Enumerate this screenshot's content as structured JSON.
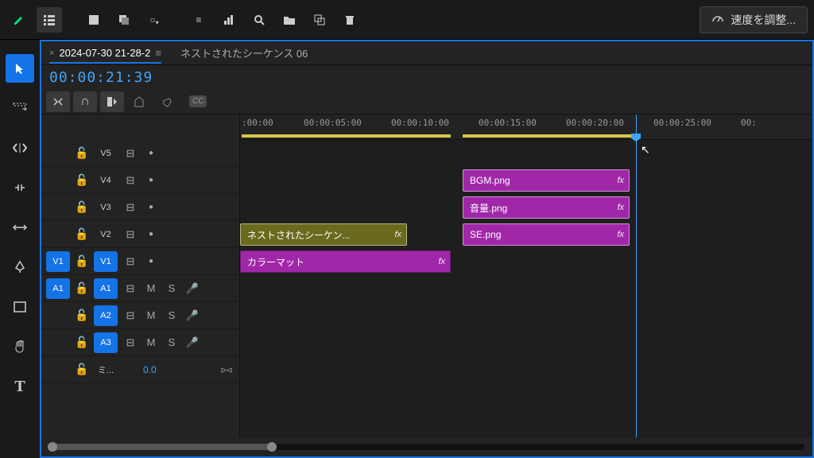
{
  "topbar": {
    "speed_label": "速度を調整..."
  },
  "tabs": {
    "active_label": "2024-07-30 21-28-2",
    "inactive_label": "ネストされたシーケンス 06"
  },
  "timecode": "00:00:21:39",
  "ruler": {
    "marks": [
      ":00:00",
      "00:00:05:00",
      "00:00:10:00",
      "00:00:15:00",
      "00:00:20:00",
      "00:00:25:00",
      "00:"
    ]
  },
  "tracks": {
    "video": [
      {
        "label": "V5"
      },
      {
        "label": "V4"
      },
      {
        "label": "V3"
      },
      {
        "label": "V2"
      },
      {
        "label": "V1",
        "targeted": true,
        "source": "V1"
      }
    ],
    "audio": [
      {
        "label": "A1",
        "targeted": true,
        "source": "A1"
      },
      {
        "label": "A2",
        "targeted": true
      },
      {
        "label": "A3",
        "targeted": true
      }
    ],
    "mixer_label": "ミ...",
    "mixer_value": "0.0"
  },
  "clips": {
    "v4": {
      "label": "BGM.png",
      "fx": "fx"
    },
    "v3": {
      "label": "音量.png",
      "fx": "fx"
    },
    "v2_a": {
      "label": "ネストされたシーケン...",
      "fx": "fx"
    },
    "v2_b": {
      "label": "SE.png",
      "fx": "fx"
    },
    "v1": {
      "label": "カラーマット",
      "fx": "fx"
    }
  },
  "audio_toggles": {
    "mute": "M",
    "solo": "S"
  },
  "cc_label": "CC"
}
